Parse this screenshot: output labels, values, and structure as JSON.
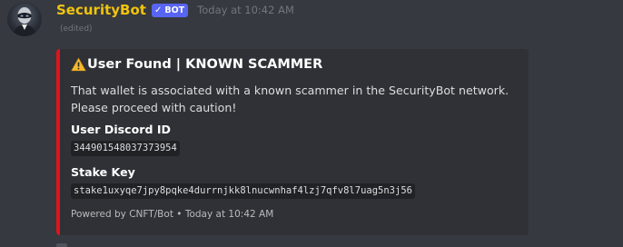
{
  "message": {
    "author": {
      "username": "SecurityBot",
      "bot_tag": "BOT",
      "bot_tag_check": "✓",
      "username_color": "#f1c40f",
      "avatar_icon": "masked-figure-avatar"
    },
    "timestamp": "Today at 10:42 AM",
    "edited_label": "(edited)"
  },
  "embed": {
    "accent_color": "#e1141b",
    "title_icon": "warning-icon",
    "title": "User Found | KNOWN SCAMMER",
    "description": "That wallet is associated with a known scammer in the SecurityBot network. Please proceed with caution!",
    "fields": [
      {
        "name": "User Discord ID",
        "value": "344901548037373954"
      },
      {
        "name": "Stake Key",
        "value": "stake1uxyqe7jpy8pqke4durrnjkk8lnucwnhaf4lzj7qfv8l7uag5n3j56"
      }
    ],
    "footer": {
      "text": "Powered by CNFT/Bot",
      "separator": "•",
      "timestamp": "Today at 10:42 AM"
    }
  }
}
